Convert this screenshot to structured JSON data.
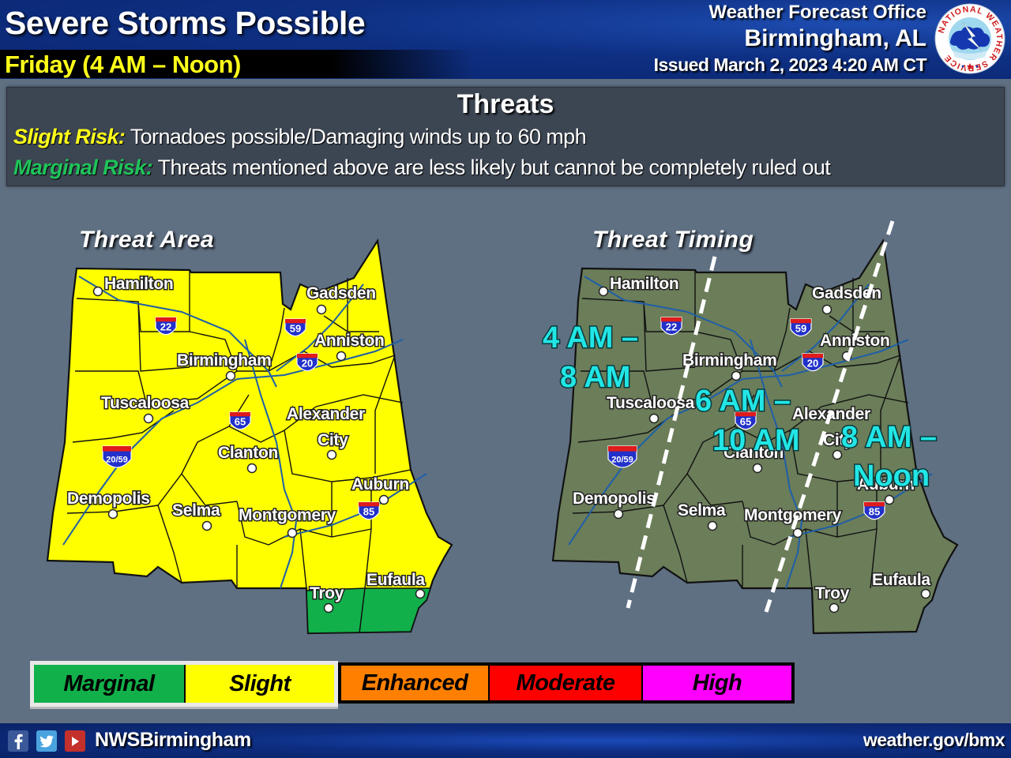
{
  "header": {
    "title": "Severe Storms Possible",
    "subtitle": "Friday (4 AM – Noon)",
    "office_line1": "Weather Forecast Office",
    "office_line2": "Birmingham, AL",
    "issued": "Issued March 2, 2023 4:20 AM CT",
    "logo": {
      "icon": "nws-logo-icon",
      "ring_text": "NATIONAL WEATHER SERVICE"
    }
  },
  "threats": {
    "title": "Threats",
    "items": [
      {
        "risk": "Slight Risk:",
        "text": " Tornadoes possible/Damaging winds up to 60 mph",
        "color": "#ffff1a"
      },
      {
        "risk": "Marginal Risk:",
        "text": " Threats mentioned above are less likely but cannot be completely ruled out",
        "color": "#1fc45a"
      }
    ]
  },
  "threat_area_map": {
    "title": "Threat Area",
    "fill_slight": "#ffff00",
    "fill_marginal": "#12b04a",
    "cities": [
      "Hamilton",
      "Gadsden",
      "Anniston",
      "Birmingham",
      "Tuscaloosa",
      "Alexander",
      "City",
      "Clanton",
      "Auburn",
      "Demopolis",
      "Selma",
      "Montgomery",
      "Troy",
      "Eufaula"
    ],
    "interstates": [
      "22",
      "59",
      "20",
      "65",
      "20/59",
      "85"
    ],
    "marginal_area": "Southeast counties (Troy, Eufaula)"
  },
  "threat_timing_map": {
    "title": "Threat Timing",
    "fill": "#6b7d59",
    "cities": [
      "Hamilton",
      "Gadsden",
      "Anniston",
      "Birmingham",
      "Tuscaloosa",
      "Alexander",
      "City",
      "Clanton",
      "Auburn",
      "Demopolis",
      "Selma",
      "Montgomery",
      "Troy",
      "Eufaula"
    ],
    "interstates": [
      "22",
      "59",
      "20",
      "65",
      "20/59",
      "85"
    ],
    "windows": [
      {
        "line1": "4 AM –",
        "line2": "8 AM"
      },
      {
        "line1": "6 AM –",
        "line2": "10 AM"
      },
      {
        "line1": "8 AM –",
        "line2": "Noon"
      }
    ],
    "label_color": "#22e6e6"
  },
  "legend": {
    "items": [
      {
        "label": "Marginal",
        "color": "#12b04a",
        "active": true
      },
      {
        "label": "Slight",
        "color": "#ffff00",
        "active": true
      },
      {
        "label": "Enhanced",
        "color": "#ff8000",
        "active": false
      },
      {
        "label": "Moderate",
        "color": "#ff0000",
        "active": false
      },
      {
        "label": "High",
        "color": "#ff00ff",
        "active": false
      }
    ]
  },
  "footer": {
    "social_icons": [
      "facebook-icon",
      "twitter-icon",
      "youtube-icon"
    ],
    "handle": "NWSBirmingham",
    "website": "weather.gov/bmx"
  }
}
